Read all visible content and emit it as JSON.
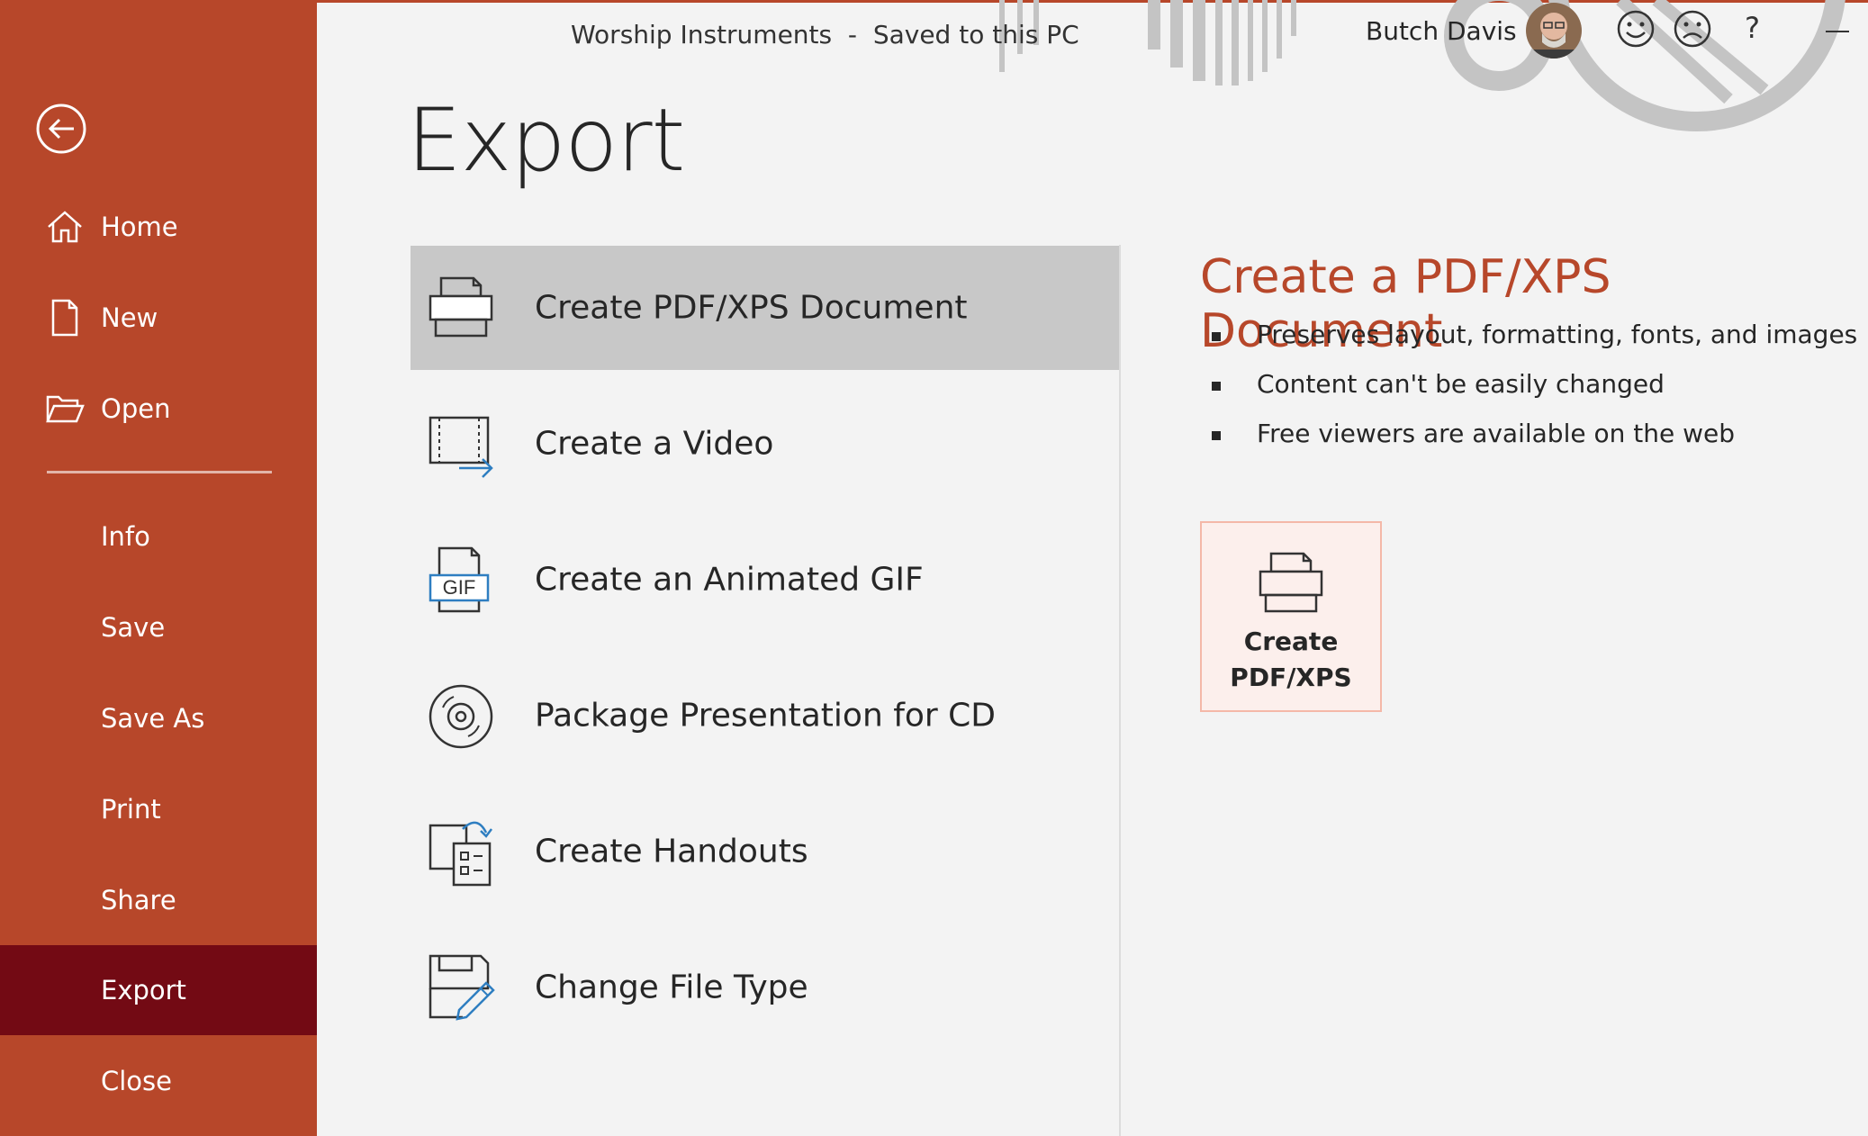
{
  "window": {
    "title": "Worship Instruments  -  Saved to this PC",
    "user_name": "Butch Davis",
    "help_label": "?"
  },
  "sidebar": {
    "back_icon": "back-arrow-circle-icon",
    "items": [
      {
        "label": "Home",
        "icon": "home-icon"
      },
      {
        "label": "New",
        "icon": "new-document-icon"
      },
      {
        "label": "Open",
        "icon": "open-folder-icon"
      },
      {
        "label": "Info"
      },
      {
        "label": "Save"
      },
      {
        "label": "Save As"
      },
      {
        "label": "Print"
      },
      {
        "label": "Share"
      },
      {
        "label": "Export",
        "active": true
      },
      {
        "label": "Close"
      }
    ],
    "background": "#b7472a",
    "active_background": "#730a14"
  },
  "main": {
    "title": "Export",
    "options": [
      {
        "label": "Create PDF/XPS Document",
        "icon": "pdf-document-icon",
        "selected": true
      },
      {
        "label": "Create a Video",
        "icon": "video-icon"
      },
      {
        "label": "Create an Animated GIF",
        "icon": "gif-icon",
        "icon_text": "GIF"
      },
      {
        "label": "Package Presentation for CD",
        "icon": "cd-icon"
      },
      {
        "label": "Create Handouts",
        "icon": "handouts-icon"
      },
      {
        "label": "Change File Type",
        "icon": "change-file-type-icon"
      }
    ]
  },
  "detail": {
    "title": "Create a PDF/XPS Document",
    "bullets": [
      "Preserves layout, formatting, fonts, and images",
      "Content can't be easily changed",
      "Free viewers are available on the web"
    ],
    "button_label": "Create\nPDF/XPS",
    "accent": "#b7472a"
  }
}
